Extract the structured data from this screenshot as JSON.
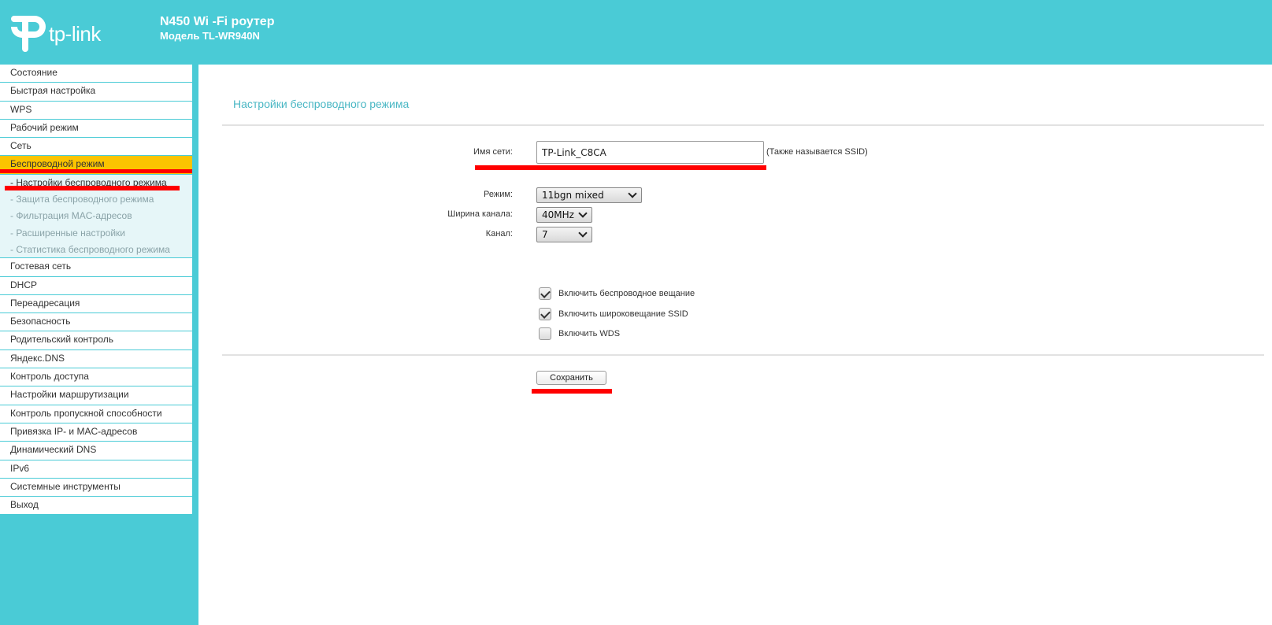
{
  "header": {
    "brand": "tp-link",
    "title": "N450 Wi -Fi роутер",
    "model": "Модель TL-WR940N"
  },
  "sidebar": {
    "items_top": [
      {
        "label": "Состояние"
      },
      {
        "label": "Быстрая настройка"
      },
      {
        "label": "WPS"
      },
      {
        "label": "Рабочий режим"
      },
      {
        "label": "Сеть"
      },
      {
        "label": "Беспроводной режим"
      }
    ],
    "sub_items": [
      {
        "label": "- Настройки беспроводного режима"
      },
      {
        "label": "- Защита беспроводного режима"
      },
      {
        "label": "- Фильтрация MAC-адресов"
      },
      {
        "label": "- Расширенные настройки"
      },
      {
        "label": "- Статистика беспроводного режима"
      }
    ],
    "items_bottom": [
      {
        "label": "Гостевая сеть"
      },
      {
        "label": "DHCP"
      },
      {
        "label": "Переадресация"
      },
      {
        "label": "Безопасность"
      },
      {
        "label": "Родительский контроль"
      },
      {
        "label": "Яндекс.DNS"
      },
      {
        "label": "Контроль доступа"
      },
      {
        "label": "Настройки маршрутизации"
      },
      {
        "label": "Контроль пропускной способности"
      },
      {
        "label": "Привязка IP- и MAC-адресов"
      },
      {
        "label": "Динамический DNS"
      },
      {
        "label": "IPv6"
      },
      {
        "label": "Системные инструменты"
      },
      {
        "label": "Выход"
      }
    ]
  },
  "main": {
    "page_title": "Настройки беспроводного режима",
    "ssid_label": "Имя сети:",
    "ssid_value": "TP-Link_C8CA",
    "ssid_hint": "(Также называется SSID)",
    "mode_label": "Режим:",
    "mode_value": "11bgn mixed",
    "width_label": "Ширина канала:",
    "width_value": "40MHz",
    "channel_label": "Канал:",
    "channel_value": "7",
    "checkboxes": [
      {
        "label": "Включить беспроводное вещание",
        "checked": true
      },
      {
        "label": "Включить широковещание SSID",
        "checked": true
      },
      {
        "label": "Включить WDS",
        "checked": false
      }
    ],
    "save_label": "Сохранить"
  },
  "colors": {
    "brand_teal": "#4acbd6",
    "active_nav": "#fbc400",
    "highlight_red": "#ff0000"
  }
}
